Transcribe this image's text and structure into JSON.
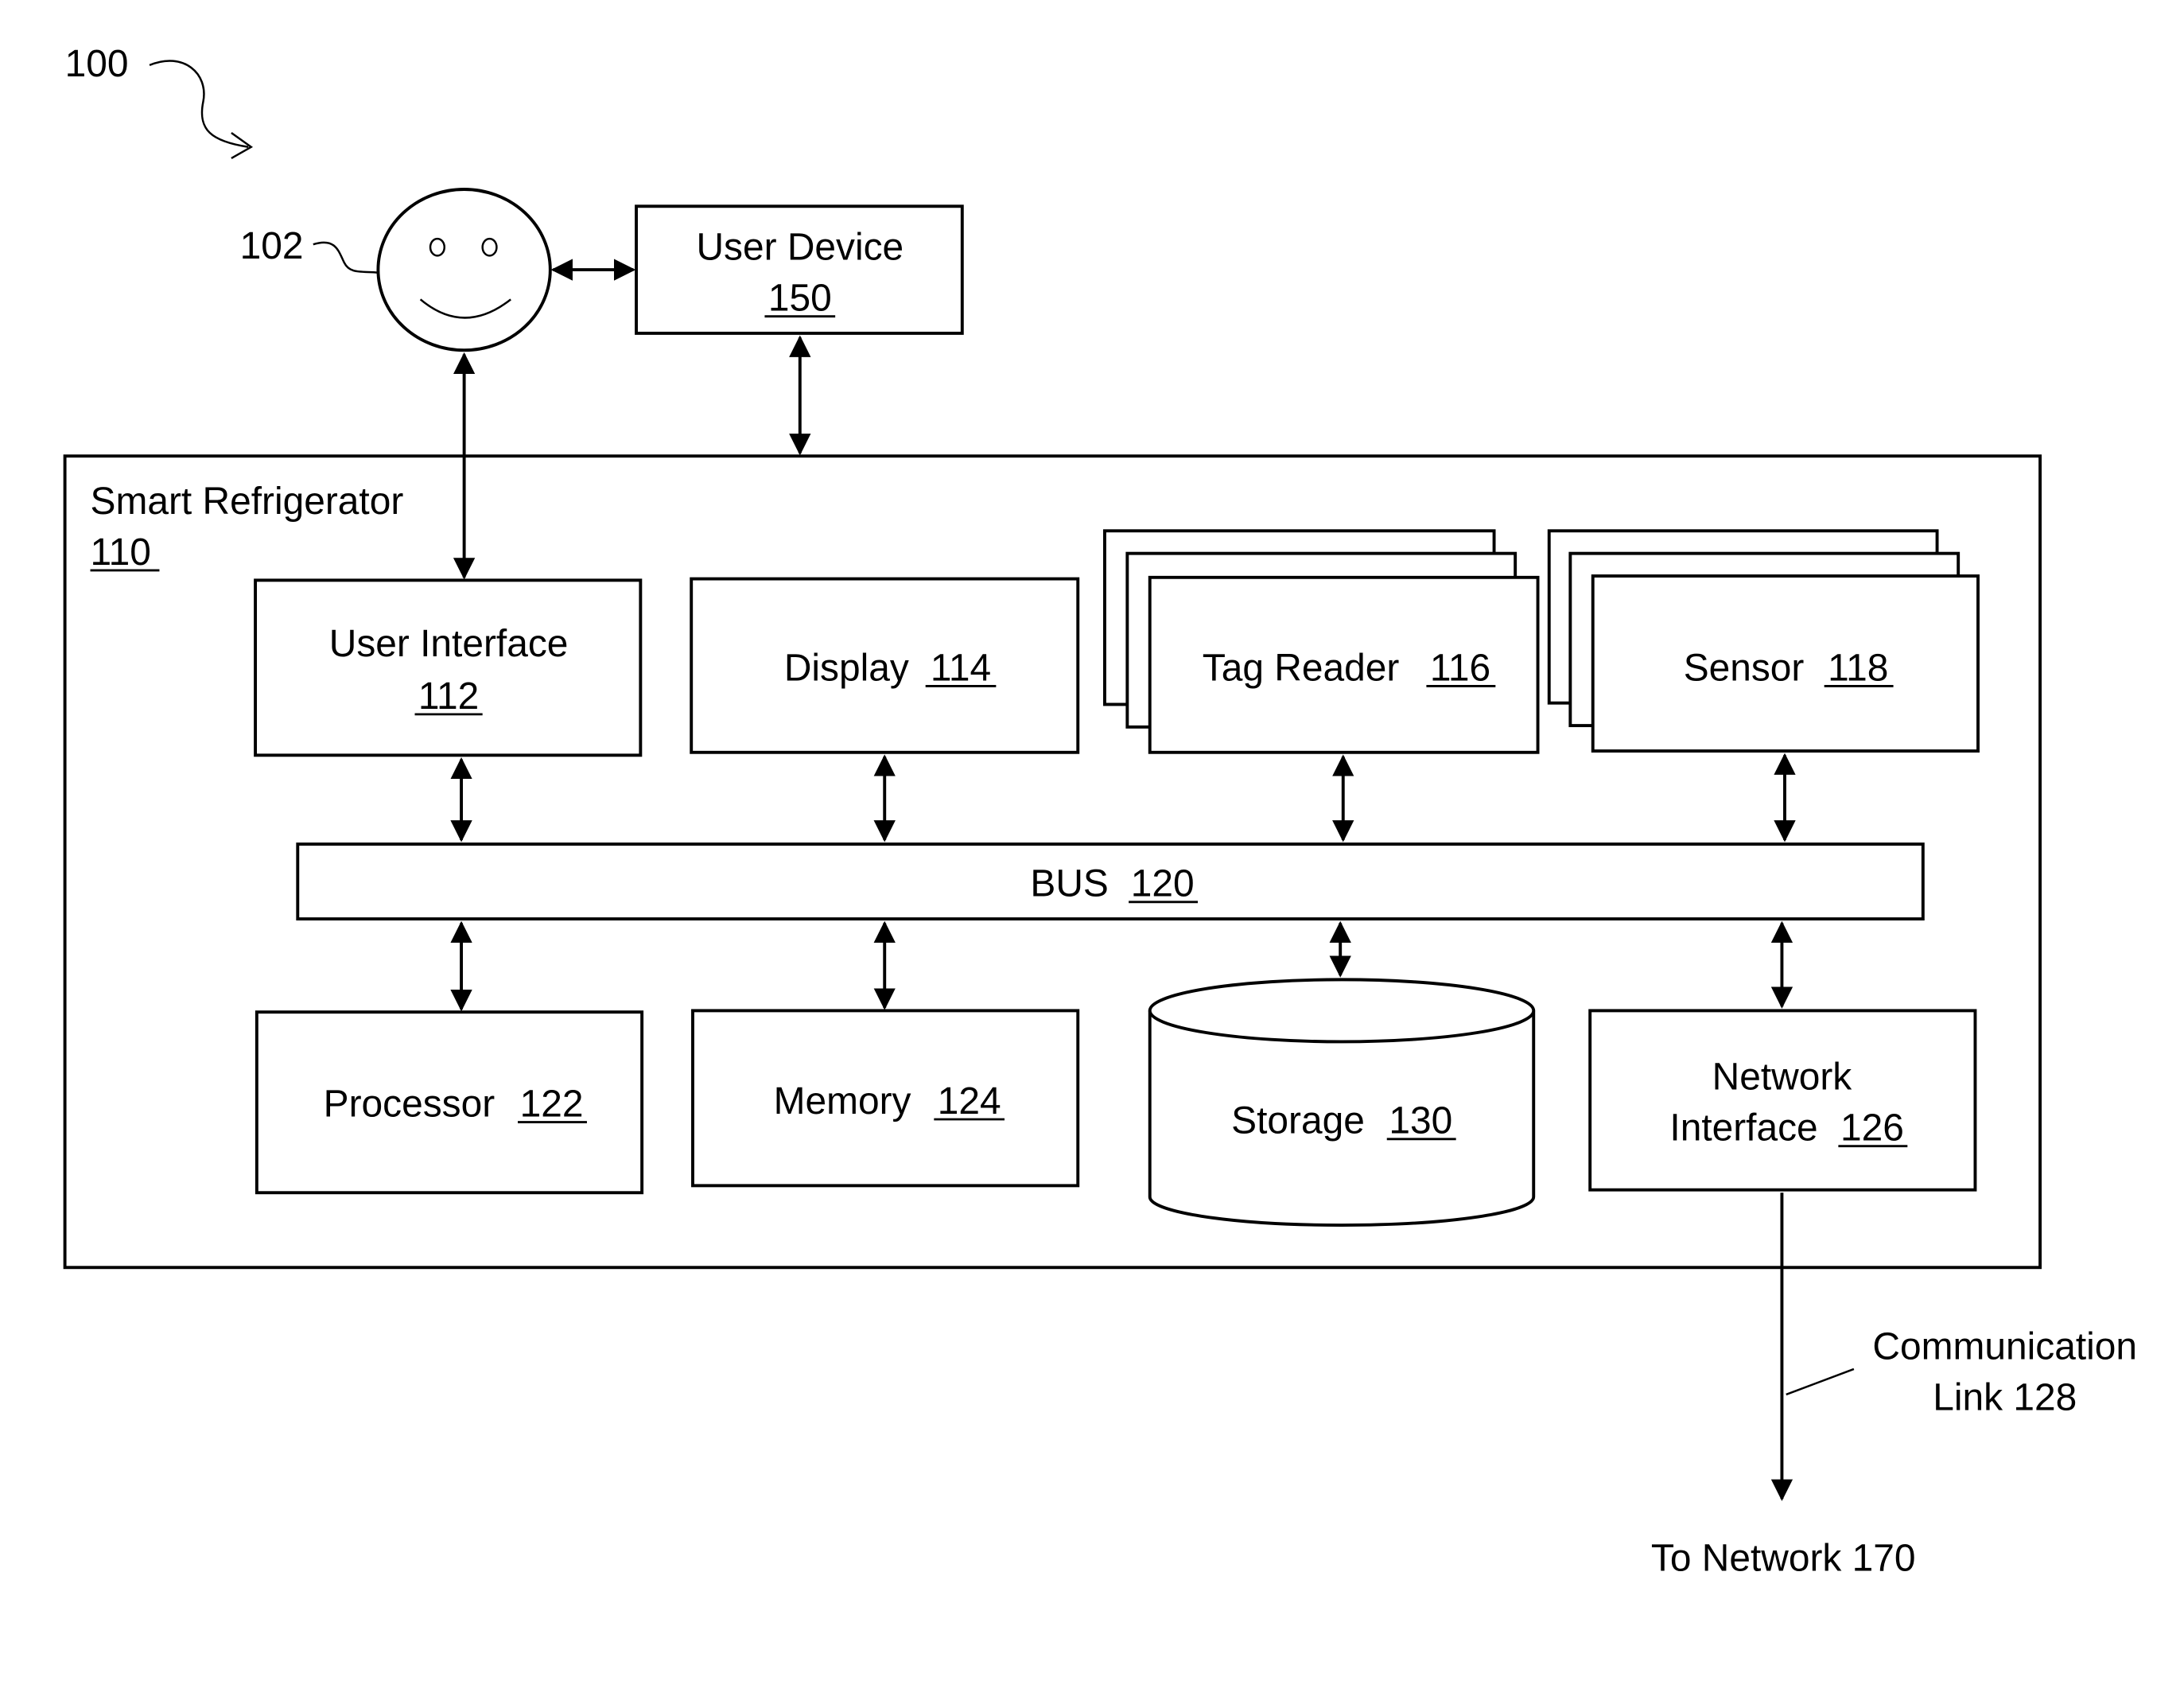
{
  "figure": {
    "ref": "100"
  },
  "user": {
    "ref": "102",
    "icon": "smiley-face-icon"
  },
  "user_device": {
    "name": "User Device",
    "ref": "150"
  },
  "refrigerator": {
    "name": "Smart Refrigerator",
    "ref": "110"
  },
  "components": {
    "user_interface": {
      "name": "User Interface",
      "ref": "112"
    },
    "display": {
      "name": "Display",
      "ref": "114"
    },
    "tag_reader": {
      "name": "Tag Reader",
      "ref": "116"
    },
    "sensor": {
      "name": "Sensor",
      "ref": "118"
    },
    "bus": {
      "name": "BUS",
      "ref": "120"
    },
    "processor": {
      "name": "Processor",
      "ref": "122"
    },
    "memory": {
      "name": "Memory",
      "ref": "124"
    },
    "storage": {
      "name": "Storage",
      "ref": "130"
    },
    "network_interface": {
      "name_line1": "Network",
      "name_line2": "Interface",
      "ref": "126"
    }
  },
  "communication_link": {
    "line1": "Communication",
    "line2": "Link 128"
  },
  "network": {
    "label": "To Network 170"
  }
}
